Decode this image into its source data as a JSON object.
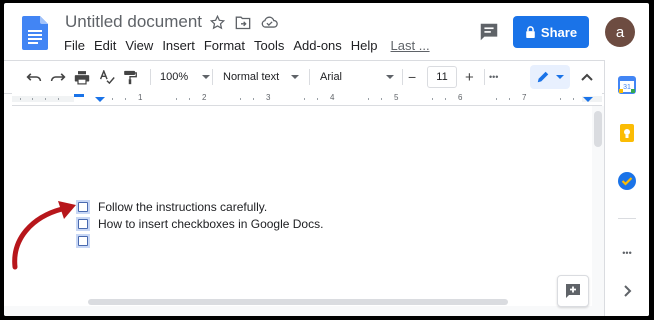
{
  "header": {
    "title": "Untitled document",
    "menu": [
      "File",
      "Edit",
      "View",
      "Insert",
      "Format",
      "Tools",
      "Add-ons",
      "Help"
    ],
    "last_edit": "Last ...",
    "share_label": "Share",
    "avatar_letter": "a"
  },
  "toolbar": {
    "zoom": "100%",
    "style": "Normal text",
    "font": "Arial",
    "font_size": "11",
    "minus": "−",
    "plus": "+",
    "more": "•••"
  },
  "ruler": {
    "marks": [
      "1",
      "2",
      "3",
      "4",
      "5",
      "6",
      "7"
    ]
  },
  "document": {
    "lines": [
      "Follow the instructions carefully.",
      "How to insert checkboxes in Google Docs.",
      ""
    ]
  },
  "side_panel": {
    "more": "•••"
  },
  "colors": {
    "accent": "#1a73e8",
    "avatar": "#6d4c41",
    "checkbox_highlight": "#c8d7f5",
    "arrow": "#b7161b"
  }
}
